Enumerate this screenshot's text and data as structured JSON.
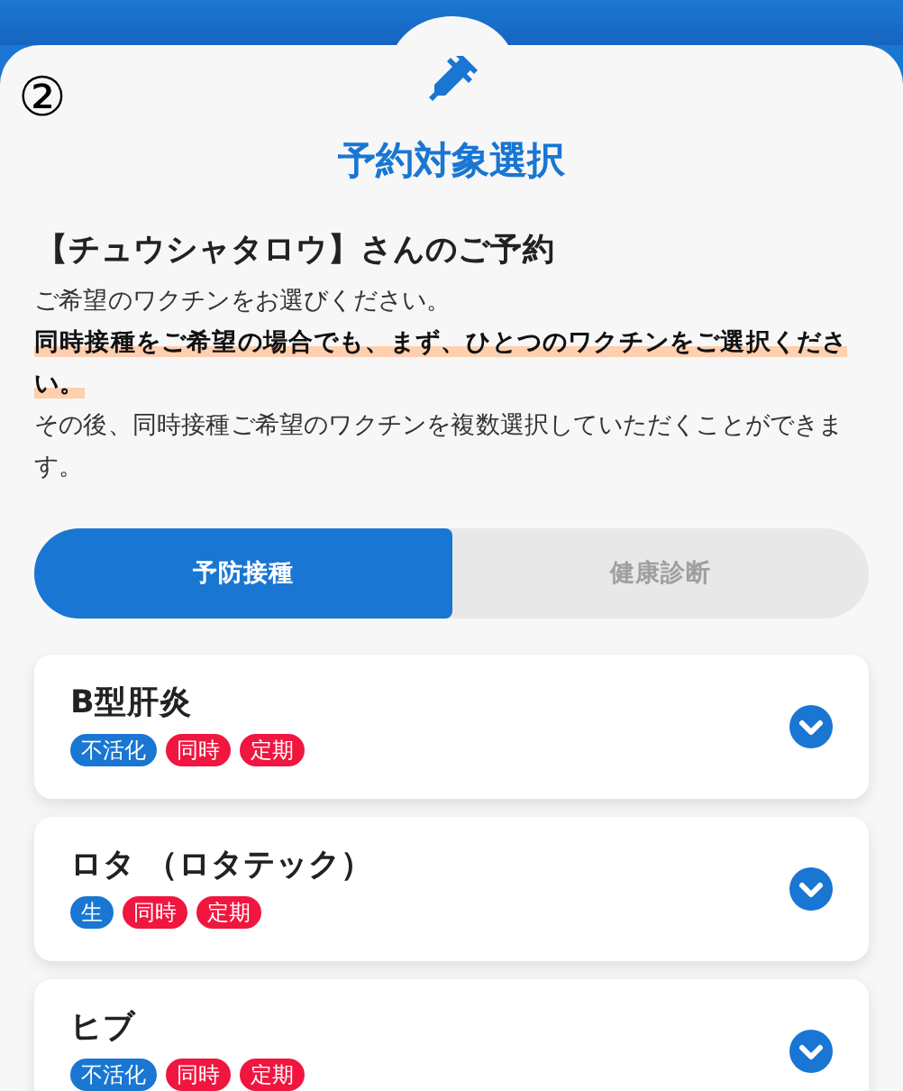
{
  "marker": "②",
  "title": "予約対象選択",
  "heading": "【チュウシャタロウ】さんのご予約",
  "lines": [
    {
      "text": "ご希望のワクチンをお選びください。",
      "emphasis": false
    },
    {
      "text": "同時接種をご希望の場合でも、まず、ひとつのワクチンをご選択ください。",
      "emphasis": true
    },
    {
      "text": "その後、同時接種ご希望のワクチンを複数選択していただくことができます。",
      "emphasis": false
    }
  ],
  "tabs": [
    {
      "label": "予防接種",
      "selected": true
    },
    {
      "label": "健康診断",
      "selected": false
    }
  ],
  "vaccines": [
    {
      "name": "B型肝炎",
      "tags": [
        {
          "label": "不活化",
          "color": "#1976d2"
        },
        {
          "label": "同時",
          "color": "#f0163f"
        },
        {
          "label": "定期",
          "color": "#f0163f"
        }
      ],
      "expanded": false
    },
    {
      "name": "ロタ （ロタテック）",
      "tags": [
        {
          "label": "生",
          "color": "#1976d2"
        },
        {
          "label": "同時",
          "color": "#f0163f"
        },
        {
          "label": "定期",
          "color": "#f0163f"
        }
      ],
      "expanded": false
    },
    {
      "name": "ヒブ",
      "tags": [
        {
          "label": "不活化",
          "color": "#1976d2"
        },
        {
          "label": "同時",
          "color": "#f0163f"
        },
        {
          "label": "定期",
          "color": "#f0163f"
        }
      ],
      "expanded": false
    }
  ]
}
